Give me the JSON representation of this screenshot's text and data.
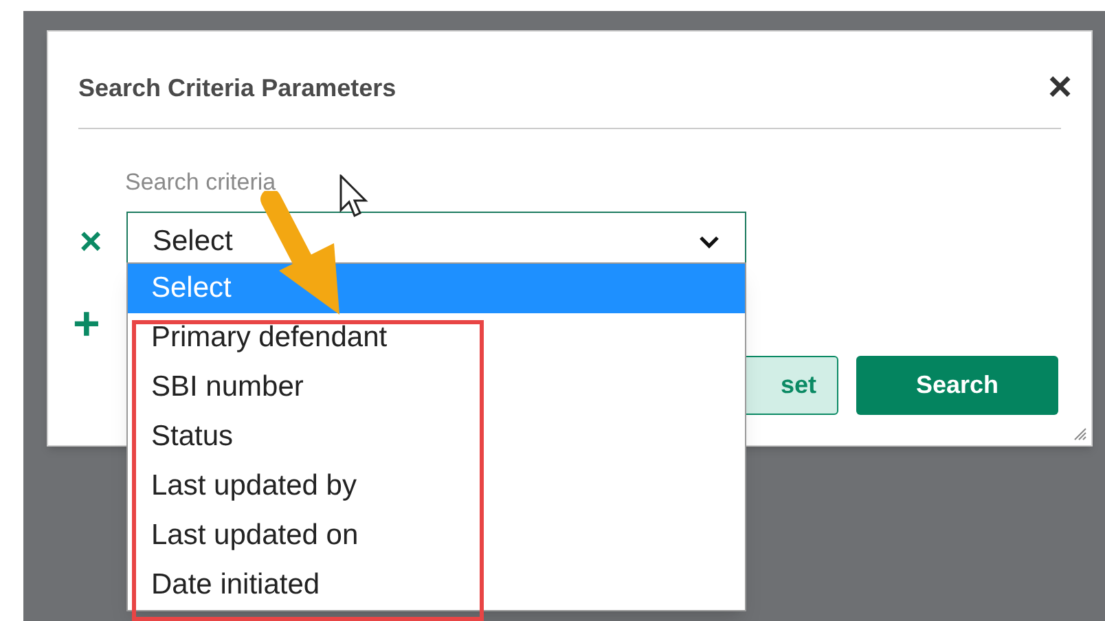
{
  "dialog": {
    "title": "Search Criteria Parameters",
    "close": "×"
  },
  "criteria": {
    "label": "Search criteria",
    "value": "Select",
    "remove": "×",
    "add": "+"
  },
  "dropdown": {
    "options": [
      {
        "label": "Select",
        "selected": true
      },
      {
        "label": "Primary defendant",
        "selected": false
      },
      {
        "label": "SBI number",
        "selected": false
      },
      {
        "label": "Status",
        "selected": false
      },
      {
        "label": "Last updated by",
        "selected": false
      },
      {
        "label": "Last updated on",
        "selected": false
      },
      {
        "label": "Date initiated",
        "selected": false
      }
    ]
  },
  "buttons": [
    {
      "label": "set",
      "kind": "secondary"
    },
    {
      "label": "Search",
      "kind": "primary"
    }
  ]
}
